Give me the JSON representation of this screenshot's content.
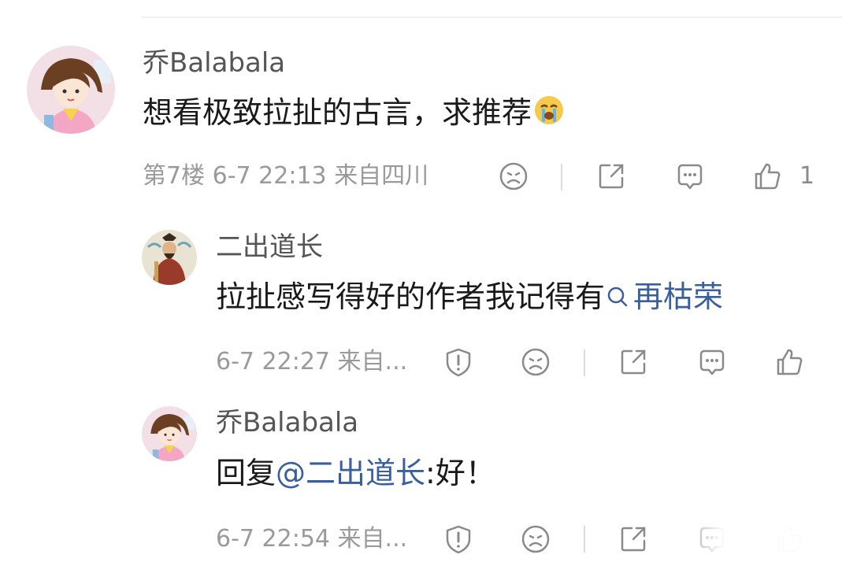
{
  "comments": [
    {
      "username": "乔Balabala",
      "text": "想看极致拉扯的古言，求推荐",
      "emoji": "crying-face",
      "floor": "第7楼",
      "time": "6-7 22:13",
      "location": "来自四川",
      "likes": "1"
    }
  ],
  "replies": [
    {
      "username": "二出道长",
      "text": "拉扯感写得好的作者我记得有",
      "search_link": "再枯荣",
      "time": "6-7 22:27",
      "location": "来自..."
    },
    {
      "username": "乔Balabala",
      "reply_prefix": "回复",
      "mention": "@二出道长",
      "text_after": ":好！",
      "time": "6-7 22:54",
      "location": "来自..."
    }
  ],
  "icons": {
    "dislike": "frown-face-icon",
    "share": "share-icon",
    "comment": "comment-icon",
    "like": "thumbs-up-icon",
    "report": "shield-icon",
    "search": "search-icon"
  },
  "colors": {
    "link": "#3a5f9e",
    "meta": "#9a9a9a",
    "text": "#1a1a1a",
    "username": "#555555"
  }
}
